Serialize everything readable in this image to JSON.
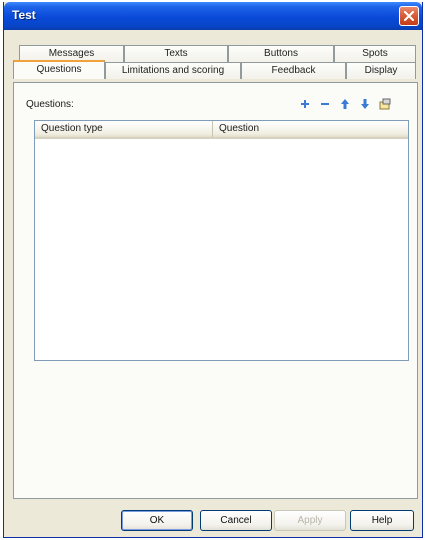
{
  "window": {
    "title": "Test"
  },
  "tabs": {
    "row1": [
      "Messages",
      "Texts",
      "Buttons",
      "Spots"
    ],
    "row2": [
      "Questions",
      "Limitations and scoring",
      "Feedback",
      "Display"
    ],
    "active": "Questions"
  },
  "questions": {
    "label": "Questions:",
    "toolbar_icons": [
      "add-icon",
      "remove-icon",
      "move-up-icon",
      "move-down-icon",
      "properties-icon"
    ],
    "columns": [
      "Question type",
      "Question"
    ],
    "rows": []
  },
  "buttons": {
    "ok": "OK",
    "cancel": "Cancel",
    "apply": "Apply",
    "help": "Help"
  },
  "colors": {
    "titlebar": "#0a4ad8",
    "dialog_bg": "#ece9d8",
    "close": "#d65a36",
    "active_tab_accent": "#f0a23c"
  }
}
